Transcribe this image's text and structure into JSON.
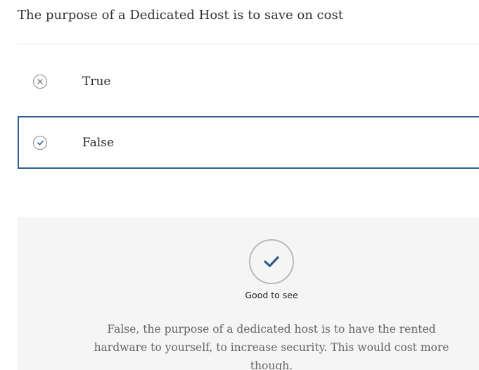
{
  "question": {
    "text": "The purpose of a Dedicated Host is to save on cost"
  },
  "options": [
    {
      "label": "True",
      "icon": "x-circle-icon",
      "selected": false
    },
    {
      "label": "False",
      "icon": "check-circle-icon",
      "selected": true
    }
  ],
  "feedback": {
    "icon": "check-icon",
    "title": "Good to see",
    "explanation": "False, the purpose of a dedicated host is to have the rented hardware to yourself, to increase security. This would cost more though."
  },
  "colors": {
    "accent": "#2f5f8f",
    "check": "#2a5d8e",
    "feedback_bg": "#f5f5f5",
    "divider": "#e6e6e6"
  }
}
